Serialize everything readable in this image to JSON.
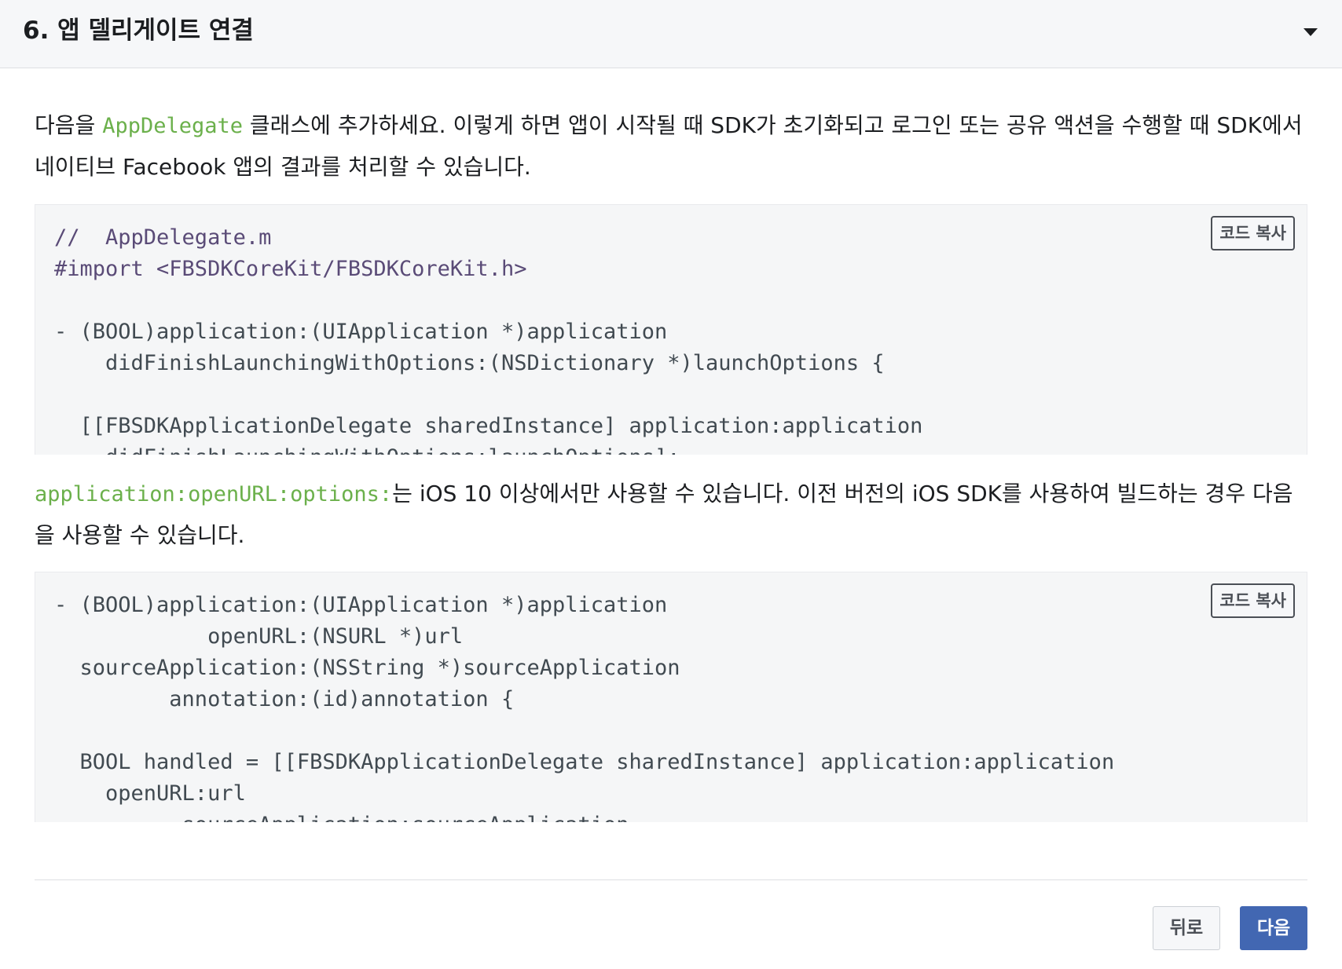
{
  "section": {
    "title": "6. 앱 델리게이트 연결"
  },
  "intro": {
    "before": "다음을 ",
    "code": "AppDelegate",
    "after": " 클래스에 추가하세요. 이렇게 하면 앱이 시작될 때 SDK가 초기화되고 로그인 또는 공유 액션을 수행할 때 SDK에서 네이티브 Facebook 앱의 결과를 처리할 수 있습니다."
  },
  "code1": {
    "copy_label": "코드 복사",
    "line1": "//  AppDelegate.m",
    "line2": "#import <FBSDKCoreKit/FBSDKCoreKit.h>",
    "line3": "- (BOOL)application:(UIApplication *)application",
    "line4": "    didFinishLaunchingWithOptions:(NSDictionary *)launchOptions {",
    "line5": "  [[FBSDKApplicationDelegate sharedInstance] application:application",
    "line6": "    didFinishLaunchingWithOptions:launchOptions];"
  },
  "note": {
    "code": "application:openURL:options:",
    "text": "는 iOS 10 이상에서만 사용할 수 있습니다. 이전 버전의 iOS SDK를 사용하여 빌드하는 경우 다음을 사용할 수 있습니다."
  },
  "code2": {
    "copy_label": "코드 복사",
    "line1": "- (BOOL)application:(UIApplication *)application",
    "line2": "            openURL:(NSURL *)url",
    "line3": "  sourceApplication:(NSString *)sourceApplication",
    "line4": "         annotation:(id)annotation {",
    "line5": "  BOOL handled = [[FBSDKApplicationDelegate sharedInstance] application:application",
    "line6": "    openURL:url",
    "line7": "          sourceApplication:sourceApplication"
  },
  "footer": {
    "back_label": "뒤로",
    "next_label": "다음"
  }
}
